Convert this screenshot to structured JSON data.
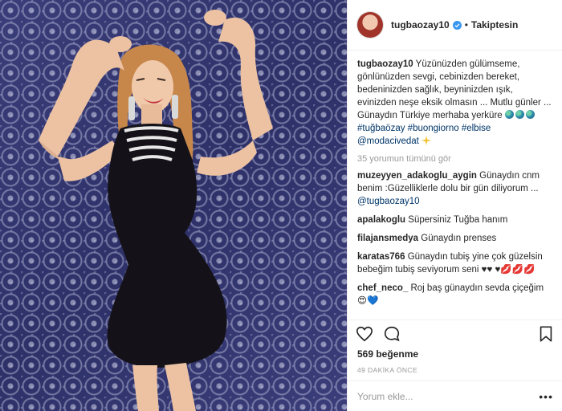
{
  "post": {
    "photo_alt": "woman in black dress posing against a patterned wall"
  },
  "header": {
    "username": "tugbaozay10",
    "verified_icon": "verified-badge-icon",
    "separator": "•",
    "follow_label": "Takiptesin"
  },
  "caption": {
    "username": "tugbaozay10",
    "text": "Yüzünüzden gülümseme, gönlünüzden sevgi, cebinizden bereket, bedeninizden sağlık, beyninizden ışık, evinizden neşe eksik olmasın ... Mutlu günler ... Günaydın Türkiye merhaba yerküre",
    "hashtag_1": "#tuğbaözay",
    "hashtag_2": "#buongiorno",
    "hashtag_3": "#elbise",
    "mention": "@modacivedat"
  },
  "view_all_comments": "35 yorumun tümünü gör",
  "comments": [
    {
      "username": "muzeyyen_adakoglu_aygin",
      "text": "Günaydın cnm benim :Güzelliklerle dolu bir gün diliyorum ...",
      "mention": "@tugbaozay10"
    },
    {
      "username": "apalakoglu",
      "text": "Süpersiniz Tuğba hanım"
    },
    {
      "username": "filajansmedya",
      "text": "Günaydın prenses"
    },
    {
      "username": "karatas766",
      "text": "Günaydın tubiş yine çok güzelsin bebeğim tubiş seviyorum seni ♥♥ ♥💋💋💋"
    },
    {
      "username": "chef_neco_",
      "text": "Roj baş günaydın sevda çiçeğim 😍💙"
    }
  ],
  "actions": {
    "like_icon": "heart-icon",
    "comment_icon": "comment-bubble-icon",
    "save_icon": "bookmark-icon"
  },
  "likes": "569 beğenme",
  "timestamp": "49 DAKİKA ÖNCE",
  "add_comment": {
    "placeholder": "Yorum ekle...",
    "more_label": "•••"
  },
  "colors": {
    "link": "#003569",
    "muted": "#999999",
    "verified": "#3897f0",
    "wall": "#34376f"
  }
}
